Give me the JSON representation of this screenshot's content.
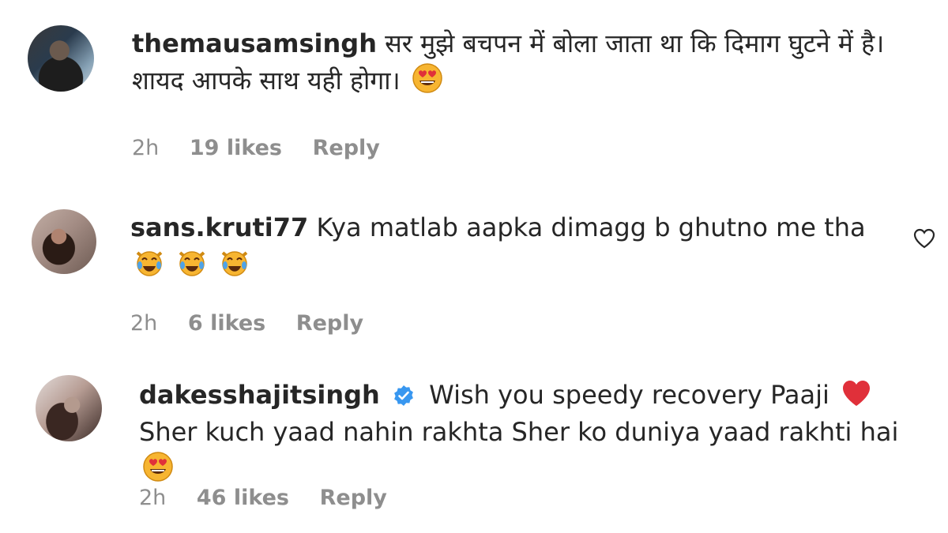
{
  "comments": [
    {
      "username": "themausamsingh",
      "text": "सर मुझे बचपन में बोला जाता था कि दिमाग घुटने में है। शायद आपके साथ यही होगा।",
      "time": "2h",
      "likes": "19 likes",
      "reply": "Reply",
      "emojis": [
        "heart-eyes-emoji"
      ]
    },
    {
      "username": "sans.kruti77",
      "text": "Kya matlab aapka dimagg b ghutno me tha",
      "time": "2h",
      "likes": "6 likes",
      "reply": "Reply",
      "emojis": [
        "cat-tears-of-joy-emoji",
        "cat-tears-of-joy-emoji",
        "cat-tears-of-joy-emoji"
      ]
    },
    {
      "username": "dakesshajitsingh",
      "verified": true,
      "text_part1": "Wish you speedy recovery Paaji",
      "text_part2": "Sher kuch yaad nahin rakhta Sher ko duniya yaad rakhti hai",
      "time": "2h",
      "likes": "46 likes",
      "reply": "Reply",
      "emojis": [
        "red-heart-emoji",
        "heart-eyes-emoji"
      ]
    }
  ],
  "colors": {
    "text": "#262626",
    "meta": "#8e8e8e",
    "verified": "#3897f0",
    "heart": "#e0303a",
    "emoji_face": "#f7b531"
  }
}
